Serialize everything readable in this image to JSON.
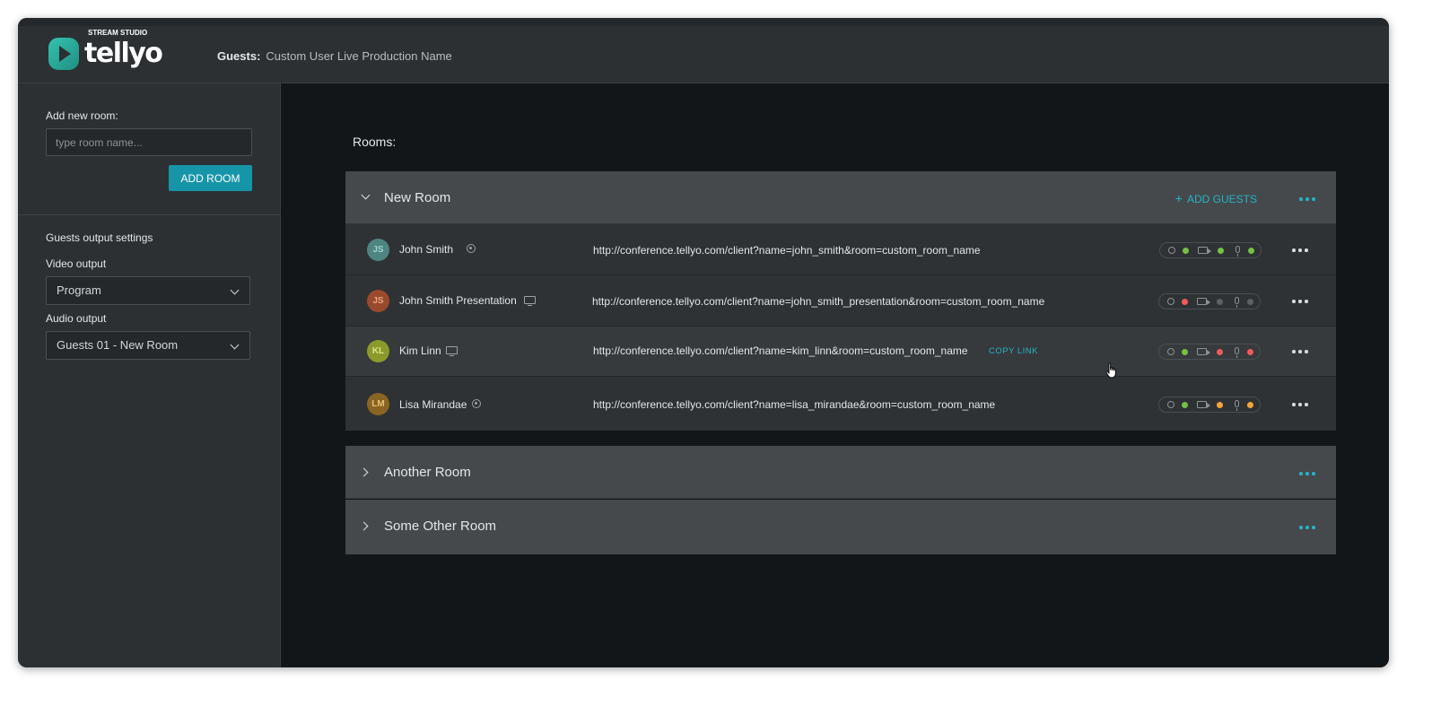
{
  "header": {
    "logo_text": "tellyo",
    "logo_subtitle": "STREAM STUDIO",
    "crumb_label": "Guests:",
    "crumb_value": "Custom User Live Production Name"
  },
  "sidebar": {
    "add_room_label": "Add new room:",
    "room_input_placeholder": "type room name...",
    "add_room_button": "ADD ROOM",
    "output_settings_label": "Guests output settings",
    "video_output_label": "Video output",
    "video_output_value": "Program",
    "audio_output_label": "Audio output",
    "audio_output_value": "Guests 01 - New Room"
  },
  "main": {
    "rooms_label": "Rooms:",
    "add_guests_label": "ADD GUESTS",
    "copy_link_label": "COPY LINK",
    "rooms": [
      {
        "name": "New Room",
        "expanded": true,
        "guests": [
          {
            "initials": "JS",
            "name": "John Smith",
            "type_icon": "webcam-icon",
            "avatar_bg": "#4e8580",
            "avatar_fg": "#9fd3cd",
            "url": "http://conference.tellyo.com/client?name=john_smith&room=custom_room_name",
            "status": {
              "link": "#76c043",
              "video": "#76c043",
              "audio": "#76c043"
            }
          },
          {
            "initials": "JS",
            "name": "John Smith Presentation",
            "type_icon": "screen-icon",
            "avatar_bg": "#9a4a2c",
            "avatar_fg": "#e8a284",
            "url": "http://conference.tellyo.com/client?name=john_smith_presentation&room=custom_room_name",
            "status": {
              "link": "#f05a5a",
              "video": "#5b6064",
              "audio": "#5b6064"
            }
          },
          {
            "initials": "KL",
            "name": "Kim Linn",
            "type_icon": "screen-icon",
            "avatar_bg": "#8c9a2c",
            "avatar_fg": "#d8e488",
            "url": "http://conference.tellyo.com/client?name=kim_linn&room=custom_room_name",
            "status": {
              "link": "#76c043",
              "video": "#f05a5a",
              "audio": "#f05a5a"
            }
          },
          {
            "initials": "LM",
            "name": "Lisa Mirandae",
            "type_icon": "webcam-icon",
            "avatar_bg": "#8a6422",
            "avatar_fg": "#e8bf72",
            "url": "http://conference.tellyo.com/client?name=lisa_mirandae&room=custom_room_name",
            "status": {
              "link": "#76c043",
              "video": "#f5a33a",
              "audio": "#f5a33a"
            }
          }
        ]
      },
      {
        "name": "Another Room",
        "expanded": false,
        "guests": []
      },
      {
        "name": "Some Other Room",
        "expanded": false,
        "guests": []
      }
    ]
  },
  "colors": {
    "accent": "#1795a8",
    "link_teal": "#26b3c6",
    "status_green": "#76c043",
    "status_red": "#f05a5a",
    "status_orange": "#f5a33a"
  }
}
